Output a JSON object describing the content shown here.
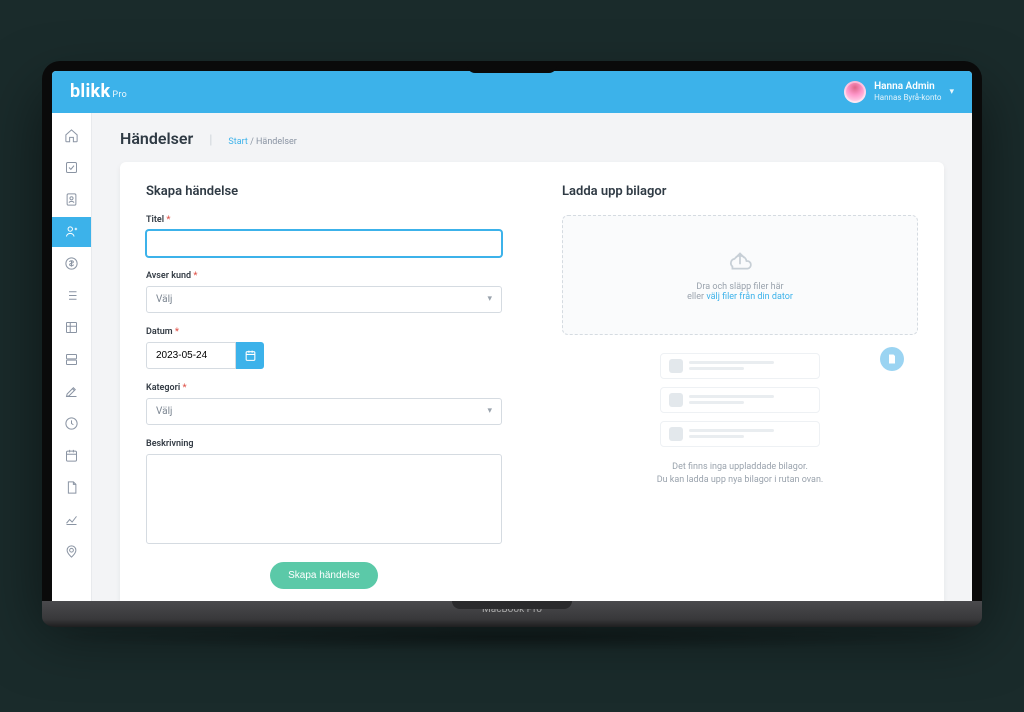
{
  "brand": {
    "name": "blikk",
    "suffix": "Pro"
  },
  "user": {
    "name": "Hanna Admin",
    "account": "Hannas Byrå-konto"
  },
  "page": {
    "title": "Händelser"
  },
  "breadcrumb": {
    "start": "Start",
    "sep": "/",
    "current": "Händelser"
  },
  "form": {
    "title": "Skapa händelse",
    "fields": {
      "titel": {
        "label": "Titel",
        "value": ""
      },
      "kund": {
        "label": "Avser kund",
        "placeholder": "Välj"
      },
      "datum": {
        "label": "Datum",
        "value": "2023-05-24"
      },
      "kategori": {
        "label": "Kategori",
        "placeholder": "Välj"
      },
      "beskrivning": {
        "label": "Beskrivning",
        "value": ""
      }
    },
    "submit_label": "Skapa händelse"
  },
  "upload": {
    "title": "Ladda upp bilagor",
    "drop_line1": "Dra och släpp filer här",
    "drop_line2_pre": "eller ",
    "drop_link": "välj filer från din dator",
    "empty_line1": "Det finns inga uppladdade bilagor.",
    "empty_line2": "Du kan ladda upp nya bilagor i rutan ovan."
  },
  "device_label": "MacBook Pro",
  "required_mark": "*"
}
